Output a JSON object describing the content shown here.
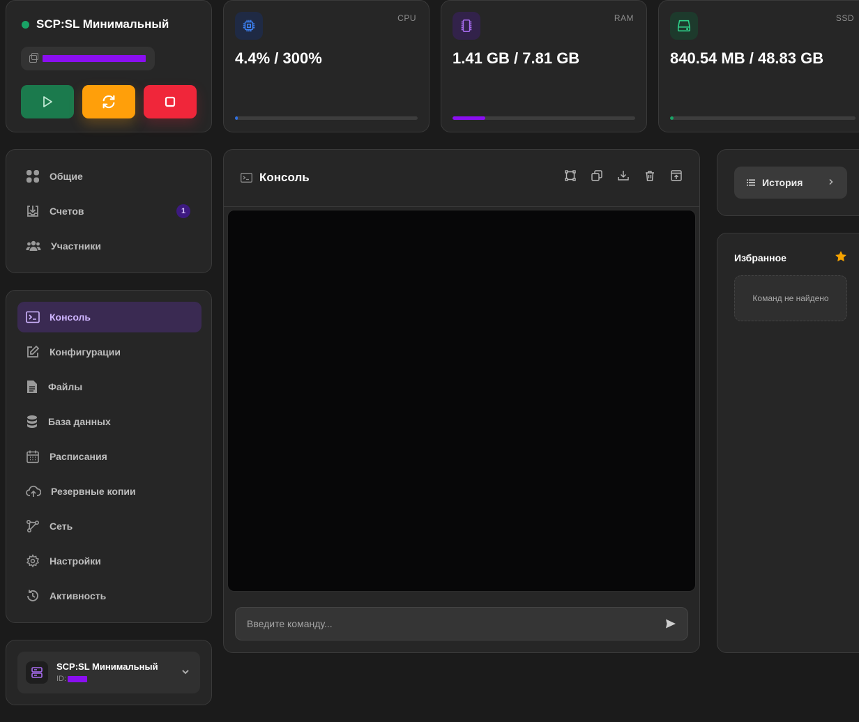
{
  "server": {
    "name": "SCP:SL Минимальный",
    "status_color": "#19a366"
  },
  "stats": {
    "cpu": {
      "label": "CPU",
      "value": "4.4% / 300%",
      "fill": 0.015,
      "color": "#2f6fe0",
      "icon": "cpu-icon"
    },
    "ram": {
      "label": "RAM",
      "value": "1.41 GB / 7.81 GB",
      "fill": 0.18,
      "color": "#8a0ff0",
      "icon": "memory-icon"
    },
    "ssd": {
      "label": "SSD",
      "value": "840.54 MB / 48.83 GB",
      "fill": 0.017,
      "color": "#19a366",
      "icon": "hard-drive-icon"
    }
  },
  "nav_top": [
    {
      "label": "Общие",
      "icon": "grid-icon"
    },
    {
      "label": "Счетов",
      "icon": "download-box-icon",
      "badge": "1"
    },
    {
      "label": "Участники",
      "icon": "users-icon"
    }
  ],
  "nav_main": [
    {
      "label": "Консоль",
      "icon": "terminal-icon",
      "active": true
    },
    {
      "label": "Конфигурации",
      "icon": "edit-icon"
    },
    {
      "label": "Файлы",
      "icon": "file-icon"
    },
    {
      "label": "База данных",
      "icon": "database-icon"
    },
    {
      "label": "Расписания",
      "icon": "calendar-icon"
    },
    {
      "label": "Резервные копии",
      "icon": "cloud-upload-icon"
    },
    {
      "label": "Сеть",
      "icon": "network-icon"
    },
    {
      "label": "Настройки",
      "icon": "gear-icon"
    },
    {
      "label": "Активность",
      "icon": "history-icon"
    }
  ],
  "selector": {
    "name": "SCP:SL Минимальный",
    "id_label": "ID:"
  },
  "console": {
    "title": "Консоль",
    "input_placeholder": "Введите команду..."
  },
  "history": {
    "label": "История"
  },
  "favorites": {
    "title": "Избранное",
    "empty_text": "Команд не найдено"
  },
  "colors": {
    "accent": "#8a0ff0",
    "start": "#1b7a4d",
    "restart": "#ff9f0a",
    "stop": "#f0263a",
    "star": "#f5a300"
  }
}
